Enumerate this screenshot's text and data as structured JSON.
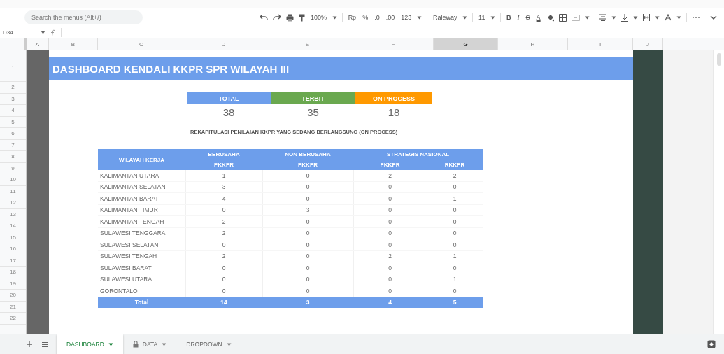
{
  "toolbar": {
    "search": {
      "placeholder": "Search the menus (Alt+/)"
    },
    "zoom": "100%",
    "currency": "Rp",
    "percent": "%",
    "decimal_decrease": ".0",
    "decimal_increase": ".00",
    "number_format": "123",
    "font": "Raleway",
    "font_size": "11",
    "bold": "B",
    "italic": "I",
    "strikethrough": "S",
    "text_color": "A"
  },
  "formula_bar": {
    "name_box": "D34"
  },
  "columns": [
    {
      "label": "A",
      "selected": false
    },
    {
      "label": "B",
      "selected": false
    },
    {
      "label": "C",
      "selected": false
    },
    {
      "label": "D",
      "selected": false
    },
    {
      "label": "E",
      "selected": false
    },
    {
      "label": "F",
      "selected": false
    },
    {
      "label": "G",
      "selected": true
    },
    {
      "label": "H",
      "selected": false
    },
    {
      "label": "I",
      "selected": false
    },
    {
      "label": "J",
      "selected": false
    }
  ],
  "rows": [
    "1",
    "2",
    "3",
    "4",
    "5",
    "6",
    "7",
    "8",
    "9",
    "10",
    "11",
    "12",
    "13",
    "14",
    "15",
    "16",
    "17",
    "18",
    "19",
    "20",
    "21",
    "22"
  ],
  "dashboard": {
    "title": "DASHBOARD KENDALI KKPR SPR WILAYAH III",
    "summary": [
      {
        "label": "TOTAL",
        "value": "38",
        "color": "#6d9eeb"
      },
      {
        "label": "TERBIT",
        "value": "35",
        "color": "#6aa84f"
      },
      {
        "label": "ON PROCESS",
        "value": "18",
        "color": "#ff9900"
      }
    ],
    "subtitle": "REKAPITULASI PENILAIAN KKPR YANG SEDANG BERLANGSUNG (ON PROCESS)",
    "table": {
      "header": {
        "region": "WILAYAH KERJA",
        "groups": [
          "BERUSAHA",
          "NON BERUSAHA",
          "STRATEGIS NASIONAL"
        ],
        "subcolumns": [
          "PKKPR",
          "PKKPR",
          "PKKPR",
          "RKKPR"
        ]
      },
      "rows": [
        [
          "KALIMANTAN UTARA",
          "1",
          "0",
          "2",
          "2"
        ],
        [
          "KALIMANTAN SELATAN",
          "3",
          "0",
          "0",
          "0"
        ],
        [
          "KALIMANTAN BARAT",
          "4",
          "0",
          "0",
          "1"
        ],
        [
          "KALIMANTAN TIMUR",
          "0",
          "3",
          "0",
          "0"
        ],
        [
          "KALIMANTAN TENGAH",
          "2",
          "0",
          "0",
          "0"
        ],
        [
          "SULAWESI TENGGARA",
          "2",
          "0",
          "0",
          "0"
        ],
        [
          "SULAWESI SELATAN",
          "0",
          "0",
          "0",
          "0"
        ],
        [
          "SULAWESI TENGAH",
          "2",
          "0",
          "2",
          "1"
        ],
        [
          "SULAWESI BARAT",
          "0",
          "0",
          "0",
          "0"
        ],
        [
          "SULAWESI UTARA",
          "0",
          "0",
          "0",
          "1"
        ],
        [
          "GORONTALO",
          "0",
          "0",
          "0",
          "0"
        ]
      ],
      "total": [
        "Total",
        "14",
        "3",
        "4",
        "5"
      ]
    }
  },
  "sheet_tabs": [
    {
      "label": "DASHBOARD",
      "selected": true,
      "locked": false
    },
    {
      "label": "DATA",
      "selected": false,
      "locked": true
    },
    {
      "label": "DROPDOWN",
      "selected": false,
      "locked": false
    }
  ]
}
